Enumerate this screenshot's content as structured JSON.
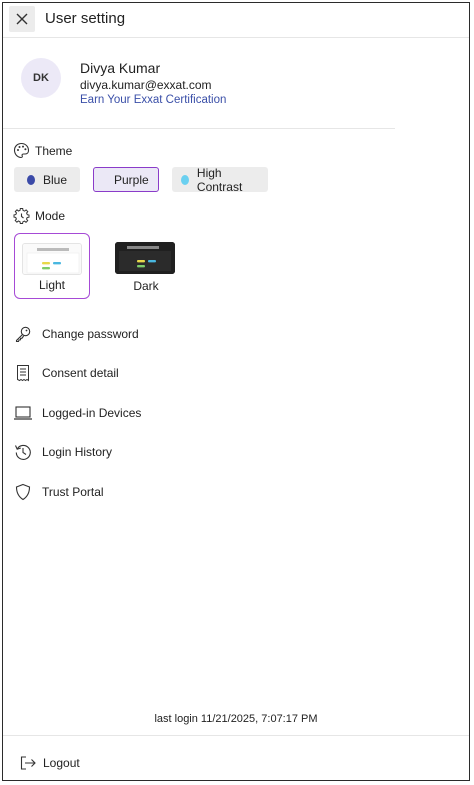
{
  "header": {
    "title": "User setting"
  },
  "profile": {
    "initials": "DK",
    "name": "Divya Kumar",
    "email": "divya.kumar@exxat.com",
    "certification_link": "Earn Your Exxat Certification"
  },
  "theme": {
    "label": "Theme",
    "options": [
      {
        "label": "Blue",
        "color": "#3b4aa8",
        "selected": false
      },
      {
        "label": "Purple",
        "color": "#7b2fc4",
        "selected": true
      },
      {
        "label": "High Contrast",
        "color": "#6ad0f0",
        "selected": false
      }
    ]
  },
  "mode": {
    "label": "Mode",
    "options": [
      {
        "label": "Light",
        "selected": true
      },
      {
        "label": "Dark",
        "selected": false
      }
    ]
  },
  "menu": [
    {
      "label": "Change password",
      "icon": "key-icon"
    },
    {
      "label": "Consent detail",
      "icon": "receipt-icon"
    },
    {
      "label": "Logged-in Devices",
      "icon": "laptop-icon"
    },
    {
      "label": "Login History",
      "icon": "history-icon"
    },
    {
      "label": "Trust Portal",
      "icon": "shield-icon"
    }
  ],
  "last_login": "last login 11/21/2025, 7:07:17 PM",
  "footer": {
    "logout_label": "Logout"
  },
  "colors": {
    "accent": "#8a3bc9",
    "link": "#3a4fa8",
    "avatar_bg": "#ece9f7"
  }
}
